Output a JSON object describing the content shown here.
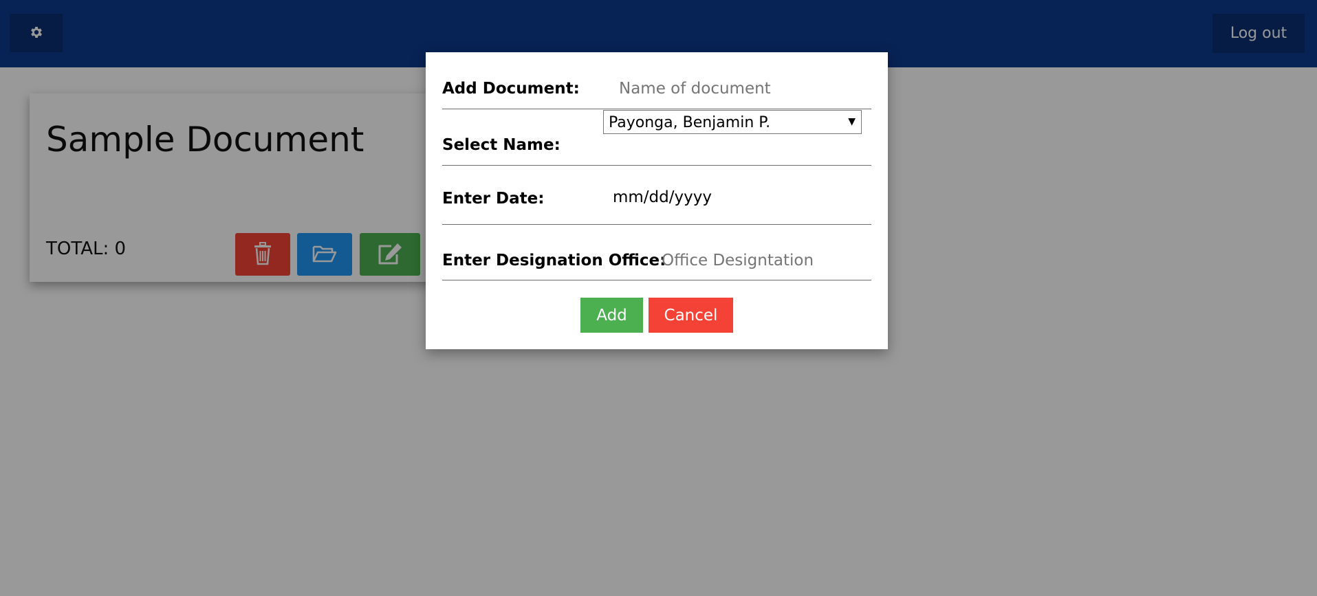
{
  "topbar": {
    "settings_icon": "gear-icon",
    "logout_label": "Log out",
    "color": "#0d3a8c"
  },
  "document_card": {
    "title": "Sample Document",
    "total_text": "TOTAL: 0",
    "actions": [
      {
        "icon": "trash-icon",
        "color": "#f44336"
      },
      {
        "icon": "folder-open-icon",
        "color": "#2196f3"
      },
      {
        "icon": "edit-icon",
        "color": "#4caf50"
      }
    ]
  },
  "modal": {
    "add_document_label": "Add Document:",
    "document_name_placeholder": "Name of document",
    "select_name_label": "Select Name:",
    "selected_name": "Payonga, Benjamin P.",
    "enter_date_label": "Enter Date:",
    "date_placeholder": "mm/dd/yyyy",
    "designation_label": "Enter Designation Office:",
    "designation_placeholder": "Office Designtation",
    "add_label": "Add",
    "cancel_label": "Cancel",
    "add_color": "#4caf50",
    "cancel_color": "#f44336"
  }
}
